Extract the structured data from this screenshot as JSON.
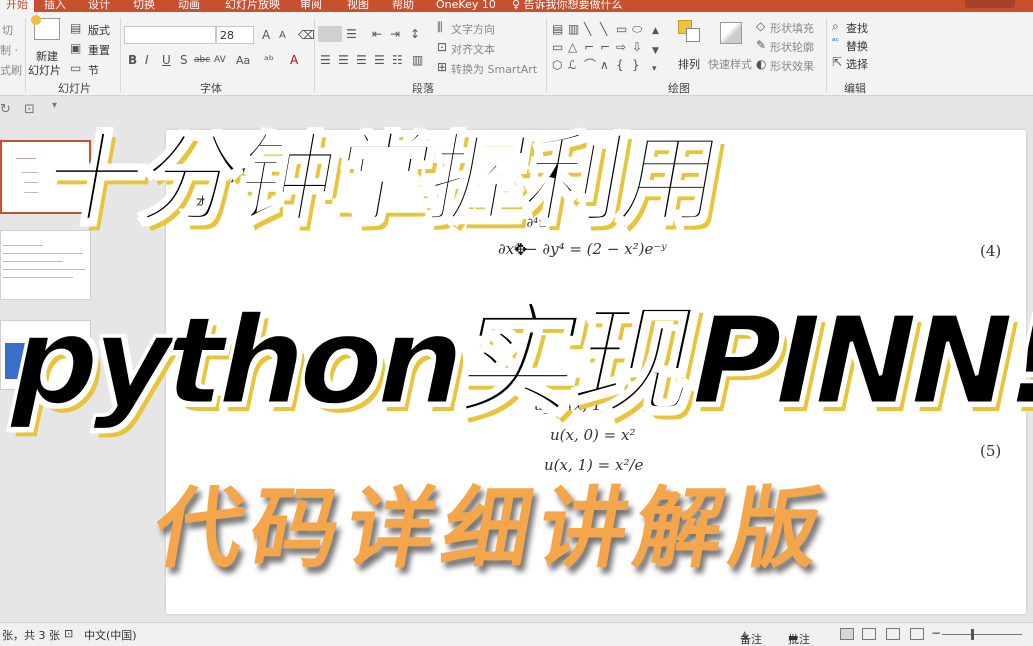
{
  "tabs": [
    {
      "label": "开始",
      "active": true
    },
    {
      "label": "插入"
    },
    {
      "label": "设计"
    },
    {
      "label": "切换"
    },
    {
      "label": "动画"
    },
    {
      "label": "幻灯片放映"
    },
    {
      "label": "审阅"
    },
    {
      "label": "视图"
    },
    {
      "label": "帮助"
    },
    {
      "label": "OneKey 10"
    },
    {
      "label": "告诉我你想要做什么"
    }
  ],
  "ribbon": {
    "clipboard": {
      "cut": "切",
      "copy": "制 ·",
      "painter": "式刷"
    },
    "slides": {
      "new_slide_line1": "新建",
      "new_slide_line2": "幻灯片",
      "layout": "版式",
      "reset": "重置",
      "section": "节",
      "group": "幻灯片"
    },
    "font": {
      "size": "28",
      "grow": "A",
      "shrink": "A",
      "bold": "B",
      "italic": "I",
      "underline": "U",
      "shadow": "S",
      "strike": "abc",
      "spacing": "AV",
      "case": "Aa",
      "color": "A",
      "group": "字体"
    },
    "paragraph": {
      "text_direction": "文字方向",
      "align_text": "对齐文本",
      "smartart": "转换为 SmartArt",
      "group": "段落"
    },
    "drawing": {
      "arrange": "排列",
      "quick_styles": "快速样式",
      "shape_fill": "形状填充",
      "shape_outline": "形状轮廓",
      "shape_effects": "形状效果",
      "group": "绘图"
    },
    "editing": {
      "find": "查找",
      "replace": "替换",
      "select": "选择",
      "group": "编辑"
    }
  },
  "slide": {
    "title": "偏微",
    "subtitle": "本次",
    "eq1": "∂x⁴ − ∂y⁴ = (2 − x²)e⁻ʸ",
    "eq1_top": "∂⁴u   ∂⁴u",
    "eq1_num": "(4)",
    "eq2_a": "u_yy(x, 1) = x²/e",
    "eq2_b": "u(x, 0) = x²",
    "eq2_c": "u(x, 1) = x²/e",
    "eq2_num": "(5)"
  },
  "overlay": {
    "line1": "十分钟掌握利用",
    "line2": "python实现PINN!",
    "line3": "代码详细讲解版"
  },
  "status": {
    "slide_info": "张，共 3 张",
    "language": "中文(中国)",
    "notes": "备注",
    "comments": "批注"
  },
  "colors": {
    "accent": "#c7502f",
    "overlay_orange": "#f5a64b",
    "overlay_shadow": "#e8c43a"
  }
}
